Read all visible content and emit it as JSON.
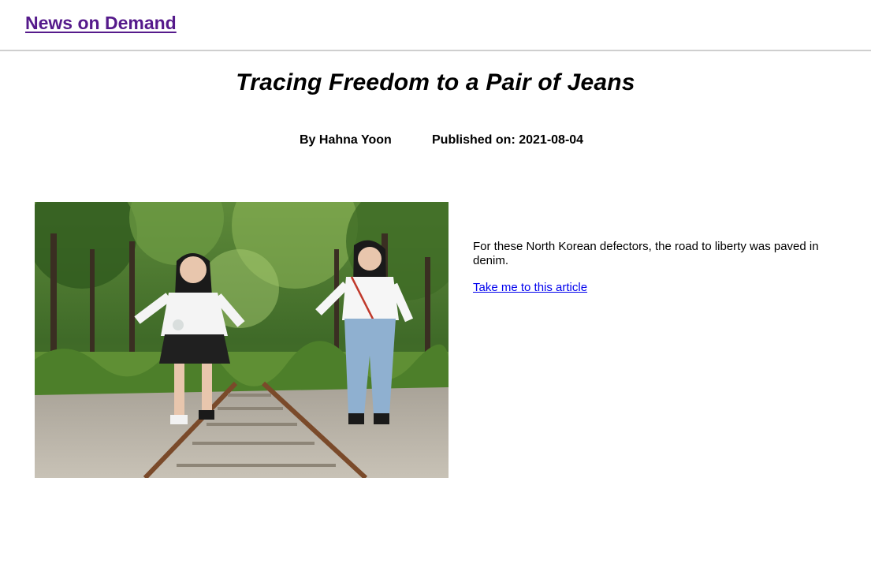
{
  "site": {
    "title": "News on Demand"
  },
  "article": {
    "title": "Tracing Freedom to a Pair of Jeans",
    "byline": "By Hahna Yoon",
    "published": "Published on: 2021-08-04",
    "summary": "For these North Korean defectors, the road to liberty was paved in denim.",
    "link_label": "Take me to this article"
  },
  "colors": {
    "visited_link": "#551a8b",
    "link": "#0000ee",
    "header_border": "#cfcfcf"
  }
}
